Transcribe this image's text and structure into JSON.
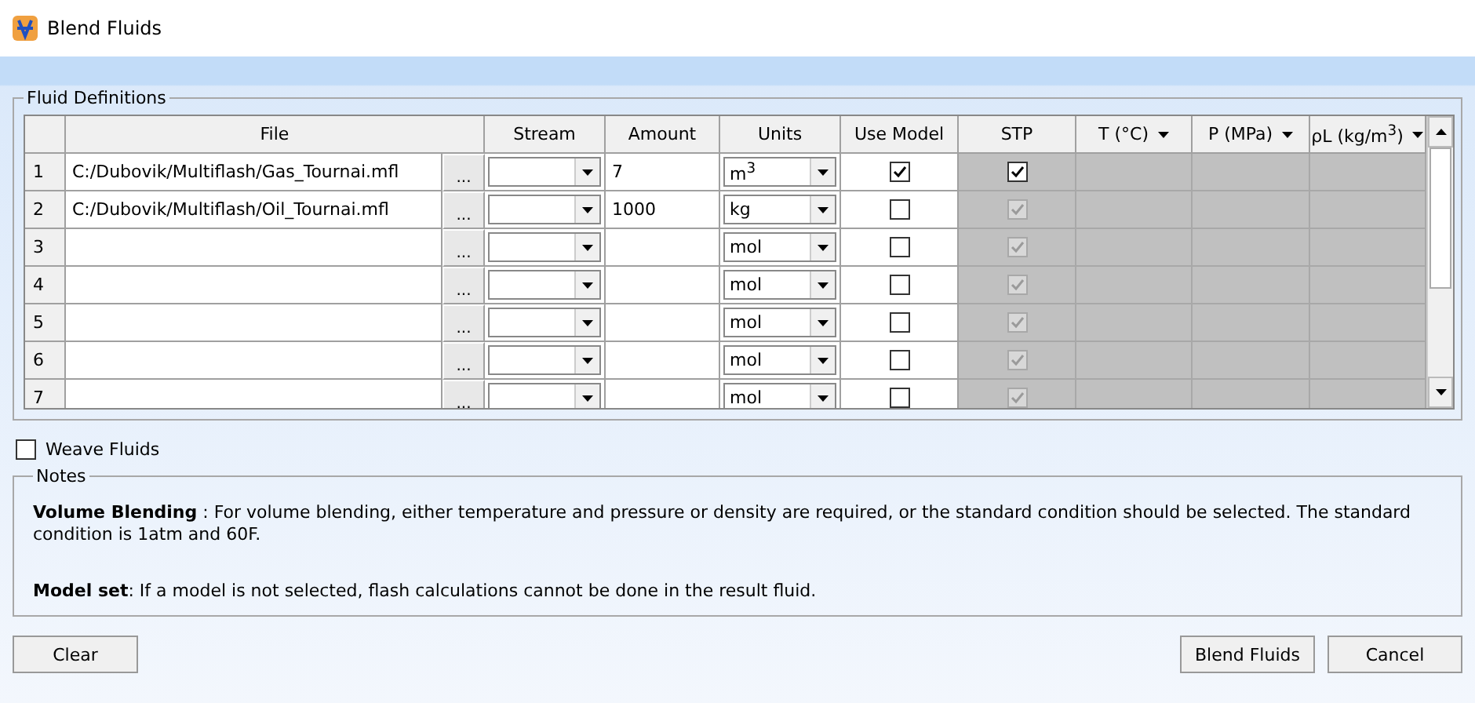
{
  "window": {
    "title": "Blend Fluids"
  },
  "fluid_definitions": {
    "title": "Fluid Definitions",
    "columns": [
      {
        "label": "File",
        "kind": "text"
      },
      {
        "label": "Stream",
        "kind": "text"
      },
      {
        "label": "Amount",
        "kind": "text"
      },
      {
        "label": "Units",
        "kind": "text"
      },
      {
        "label": "Use Model",
        "kind": "text"
      },
      {
        "label": "STP",
        "kind": "text"
      },
      {
        "label": "T (°C)",
        "kind": "menu"
      },
      {
        "label": "P (MPa)",
        "kind": "menu"
      },
      {
        "label": "ρL (kg/m$^{3}$)",
        "kind": "menu"
      }
    ],
    "rows": [
      {
        "number": "1",
        "file": "C:/Dubovik/Multiflash/Gas_Tournai.mfl",
        "browse": "...",
        "amount": "7",
        "units": "m$^{3}$",
        "use_model": true,
        "stp": true,
        "stp_disabled": false
      },
      {
        "number": "2",
        "file": "C:/Dubovik/Multiflash/Oil_Tournai.mfl",
        "browse": "...",
        "amount": "1000",
        "units": "kg",
        "use_model": false,
        "stp": true,
        "stp_disabled": true
      },
      {
        "number": "3",
        "file": "",
        "browse": "...",
        "amount": "",
        "units": "mol",
        "use_model": false,
        "stp": true,
        "stp_disabled": true
      },
      {
        "number": "4",
        "file": "",
        "browse": "...",
        "amount": "",
        "units": "mol",
        "use_model": false,
        "stp": true,
        "stp_disabled": true
      },
      {
        "number": "5",
        "file": "",
        "browse": "...",
        "amount": "",
        "units": "mol",
        "use_model": false,
        "stp": true,
        "stp_disabled": true
      },
      {
        "number": "6",
        "file": "",
        "browse": "...",
        "amount": "",
        "units": "mol",
        "use_model": false,
        "stp": true,
        "stp_disabled": true
      },
      {
        "number": "7",
        "file": "",
        "browse": "...",
        "amount": "",
        "units": "mol",
        "use_model": false,
        "stp": true,
        "stp_disabled": true
      }
    ]
  },
  "weave_fluids": {
    "label": "Weave Fluids",
    "checked": false
  },
  "notes": {
    "title": "Notes",
    "paragraphs": [
      "**Volume Blending** : For volume blending, either temperature and pressure or density are required, or the standard condition should be selected. The standard condition is 1atm and 60F.",
      "**Model set**: If a model is not selected, flash calculations cannot be done in the result fluid."
    ]
  },
  "buttons": [
    {
      "label": "Clear",
      "kind": "left"
    },
    {
      "label": "Blend Fluids",
      "kind": "right"
    },
    {
      "label": "Cancel",
      "kind": "right"
    }
  ]
}
